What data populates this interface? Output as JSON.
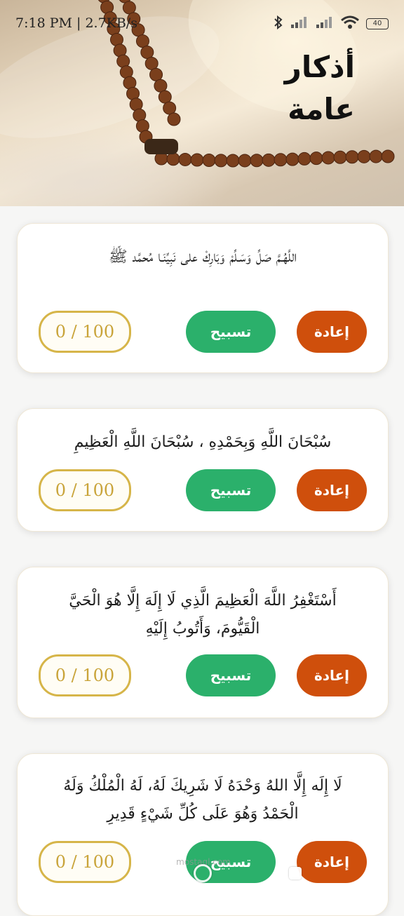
{
  "status_bar": {
    "time": "7:18 PM",
    "data_speed": "2.7KB/s",
    "battery": "40"
  },
  "header": {
    "title": "أذكار عامة"
  },
  "cards": [
    {
      "text": "اللَّهُـمَّ صَلِّ وَسَـلِّمْ وَبَارِكْ على نَبِيِّنَـا مُحمَّد ﷺ",
      "reset_label": "إعادة",
      "tasbih_label": "تسبيح",
      "counter": "0 / 100"
    },
    {
      "text": "سُبْحَانَ اللَّهِ وَبِحَمْدِهِ ، سُبْحَانَ اللَّهِ الْعَظِيمِ",
      "reset_label": "إعادة",
      "tasbih_label": "تسبيح",
      "counter": "0 / 100"
    },
    {
      "text": "أَسْتَغْفِرُ اللَّهَ الْعَظِيمَ الَّذِي لَا إِلَهَ إِلَّا هُوَ الْحَيَّ الْقَيُّومَ، وَأَتُوبُ إِلَيْهِ",
      "reset_label": "إعادة",
      "tasbih_label": "تسبيح",
      "counter": "0 / 100"
    },
    {
      "text": "لَا إِلَه إِلَّا اللهُ وَحْدَهُ لَا شَرِيكَ لَهُ، لَهُ الْمُلْكُ وَلَهُ الْحَمْدُ وَهُوَ عَلَى كُلِّ شَيْءٍ قَدِيرِ",
      "reset_label": "إعادة",
      "tasbih_label": "تسبيح",
      "counter": "0 / 100"
    }
  ],
  "watermark": "mostaql.com",
  "colors": {
    "reset": "#cf4f0c",
    "tasbih": "#2bb06b",
    "counter_border": "#d6b549"
  },
  "icons": [
    "bluetooth-icon",
    "signal-icon",
    "wifi-icon",
    "battery-icon",
    "alarm-icon"
  ]
}
